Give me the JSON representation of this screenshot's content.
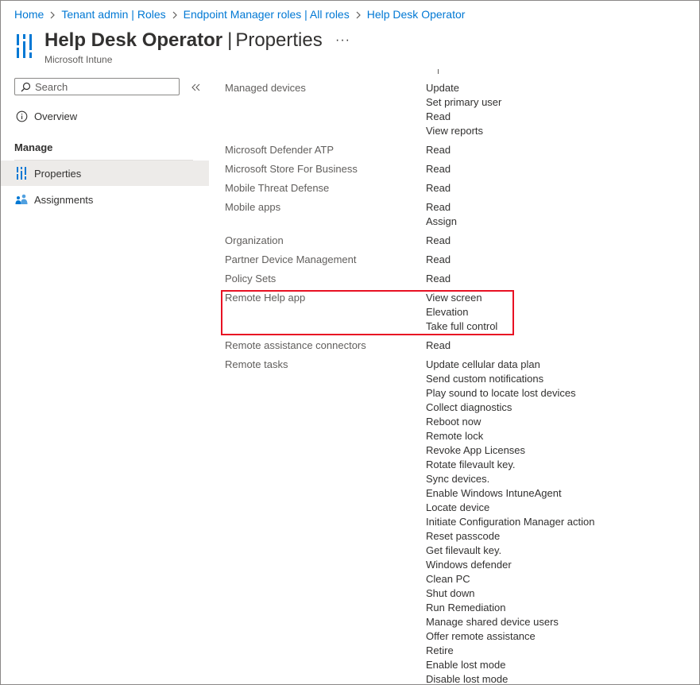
{
  "breadcrumb": [
    "Home",
    "Tenant admin | Roles",
    "Endpoint Manager roles | All roles",
    "Help Desk Operator"
  ],
  "header": {
    "title": "Help Desk Operator",
    "separator": "|",
    "subtitle_page": "Properties",
    "service": "Microsoft Intune",
    "more_label": "···"
  },
  "sidebar": {
    "search_placeholder": "Search",
    "overview_label": "Overview",
    "section_label": "Manage",
    "items": [
      {
        "label": "Properties",
        "active": true
      },
      {
        "label": "Assignments",
        "active": false
      }
    ]
  },
  "permissions": [
    {
      "category": "Managed devices",
      "perms": [
        "Update",
        "Set primary user",
        "Read",
        "View reports"
      ]
    },
    {
      "category": "Microsoft Defender ATP",
      "perms": [
        "Read"
      ]
    },
    {
      "category": "Microsoft Store For Business",
      "perms": [
        "Read"
      ]
    },
    {
      "category": "Mobile Threat Defense",
      "perms": [
        "Read"
      ]
    },
    {
      "category": "Mobile apps",
      "perms": [
        "Read",
        "Assign"
      ]
    },
    {
      "category": "Organization",
      "perms": [
        "Read"
      ]
    },
    {
      "category": "Partner Device Management",
      "perms": [
        "Read"
      ]
    },
    {
      "category": "Policy Sets",
      "perms": [
        "Read"
      ]
    },
    {
      "category": "Remote Help app",
      "perms": [
        "View screen",
        "Elevation",
        "Take full control"
      ]
    },
    {
      "category": "Remote assistance connectors",
      "perms": [
        "Read"
      ]
    },
    {
      "category": "Remote tasks",
      "perms": [
        "Update cellular data plan",
        "Send custom notifications",
        "Play sound to locate lost devices",
        "Collect diagnostics",
        "Reboot now",
        "Remote lock",
        "Revoke App Licenses",
        "Rotate filevault key.",
        "Sync devices.",
        "Enable Windows IntuneAgent",
        "Locate device",
        "Initiate Configuration Manager action",
        "Reset passcode",
        "Get filevault key.",
        "Windows defender",
        "Clean PC",
        "Shut down",
        "Run Remediation",
        "Manage shared device users",
        "Offer remote assistance",
        "Retire",
        "Enable lost mode",
        "Disable lost mode"
      ]
    }
  ],
  "highlight_color": "#e81123",
  "accent_color": "#0078d4"
}
